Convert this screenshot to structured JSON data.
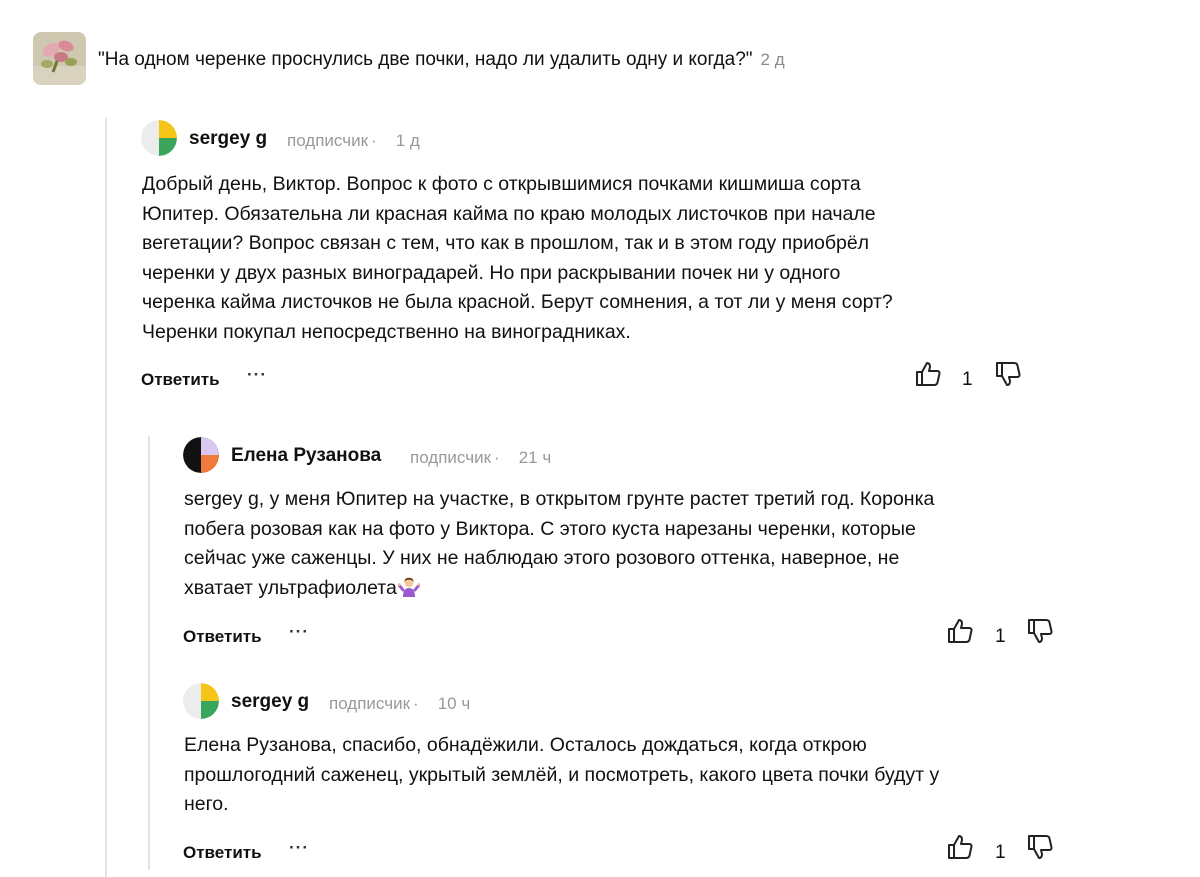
{
  "post": {
    "title": "\"На одном черенке проснулись две почки, надо ли удалить одну и когда?\"",
    "time": "2 д"
  },
  "comments": [
    {
      "author": "sergey g",
      "role": "подписчик",
      "time": "1 д",
      "avatar_icon": "yellow-green-avatar-icon",
      "lines": [
        "Добрый день, Виктор. Вопрос к фото с открывшимися почками кишмиша сорта",
        "Юпитер. Обязательна ли красная кайма по краю молодых листочков при начале",
        "вегетации? Вопрос связан с тем, что как в прошлом, так и в этом году приобрёл",
        "черенки у двух разных виноградарей. Но при раскрывании почек ни у одного",
        "черенка кайма листочков не была красной. Берут сомнения, а тот ли у меня сорт?",
        "Черенки покупал непосредственно на виноградниках."
      ],
      "reply_label": "Ответить",
      "more_label": "···",
      "likes": "1"
    },
    {
      "author": "Елена Рузанова",
      "role": "подписчик",
      "time": "21 ч",
      "avatar_icon": "black-orange-avatar-icon",
      "lines": [
        "sergey g, у меня Юпитер на участке, в открытом грунте растет третий год. Коронка",
        "побега розовая как на фото у Виктора. С этого куста нарезаны черенки, которые",
        "сейчас уже саженцы. У них не наблюдаю этого розового оттенка, наверное, не",
        "хватает ультрафиолета"
      ],
      "emoji": "person-shrugging-icon",
      "reply_label": "Ответить",
      "more_label": "···",
      "likes": "1"
    },
    {
      "author": "sergey g",
      "role": "подписчик",
      "time": "10 ч",
      "avatar_icon": "yellow-green-avatar-icon",
      "lines": [
        "Елена Рузанова, спасибо, обнадёжили. Осталось дождаться, когда открою",
        "прошлогодний саженец, укрытый землёй, и посмотреть, какого цвета почки будут у",
        "него."
      ],
      "reply_label": "Ответить",
      "more_label": "···",
      "likes": "1"
    }
  ],
  "icons": {
    "like": "thumbs-up-icon",
    "dislike": "thumbs-down-icon"
  }
}
